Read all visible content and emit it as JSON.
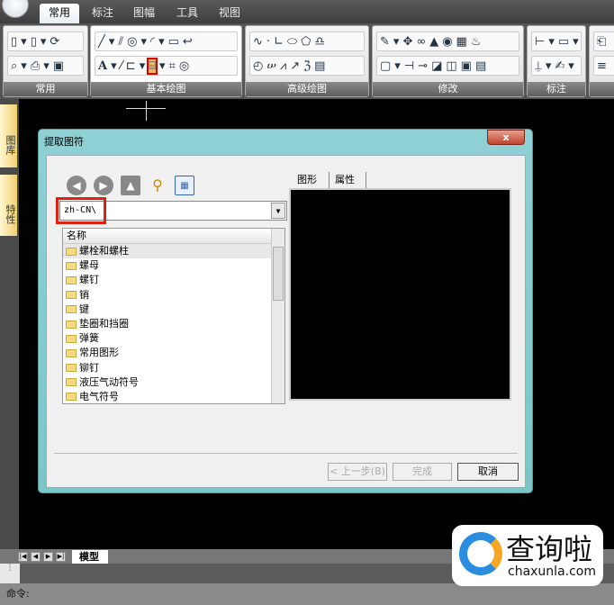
{
  "menu_tabs": [
    "常用",
    "标注",
    "图幅",
    "工具",
    "视图"
  ],
  "active_tab": "常用",
  "ribbon_panels": [
    {
      "label": "常用",
      "row1": [
        "▯",
        "▾",
        "▯",
        "▾",
        "⟳"
      ],
      "row2": [
        "⌕",
        "▾",
        "⎙",
        "▾",
        "▣"
      ]
    },
    {
      "label": "基本绘图",
      "row1": [
        "╱",
        "▾",
        "⫽",
        "◎",
        "▾",
        "◜",
        "▾",
        "▭",
        "↩"
      ],
      "row2": [
        "A",
        "▾",
        "⁄",
        "⊏",
        "▾",
        "⌸",
        "▾",
        "⌗",
        "◎"
      ]
    },
    {
      "label": "高级绘图",
      "row1": [
        "∿",
        "·",
        "∟",
        "⬭",
        "⬠",
        "♎"
      ],
      "row2": [
        "◴",
        "ሠ",
        "⩘",
        "↗",
        "ℨ",
        "▤"
      ]
    },
    {
      "label": "修改",
      "row1": [
        "✎",
        "▾",
        "✥",
        "∞",
        "▲",
        "◉",
        "▦",
        "♨"
      ],
      "row2": [
        "▢",
        "▾",
        "⊣",
        "⊸",
        "◪",
        "◫",
        "▣",
        "▤"
      ]
    },
    {
      "label": "标注",
      "row1": [
        "⊢",
        "▾",
        "▭",
        "▾"
      ],
      "row2": [
        "⍊",
        "▾",
        "✍",
        "▾"
      ]
    },
    {
      "label": "",
      "row1": [
        "⎗"
      ],
      "row2": [
        "≡"
      ]
    }
  ],
  "highlighted_tool": "extract-symbol",
  "side_tabs": [
    "图库",
    "特性"
  ],
  "dialog": {
    "title": "提取图符",
    "close": "x",
    "path": "zh-CN\\",
    "list_header": "名称",
    "items": [
      "螺栓和螺柱",
      "螺母",
      "螺钉",
      "销",
      "键",
      "垫圈和挡圈",
      "弹簧",
      "常用图形",
      "铆钉",
      "液压气动符号",
      "电气符号"
    ],
    "preview_tabs": [
      "图形",
      "属性"
    ],
    "buttons": {
      "back": "< 上一步(B)",
      "finish": "完成",
      "cancel": "取消"
    }
  },
  "model_tab": "模型",
  "command_label": "命令:",
  "watermark": {
    "text": "查询啦",
    "url": "chaxunla.com"
  },
  "colors": {
    "highlight": "#dd1111",
    "title_bar": "#8fd0d4",
    "canvas": "#000000"
  }
}
